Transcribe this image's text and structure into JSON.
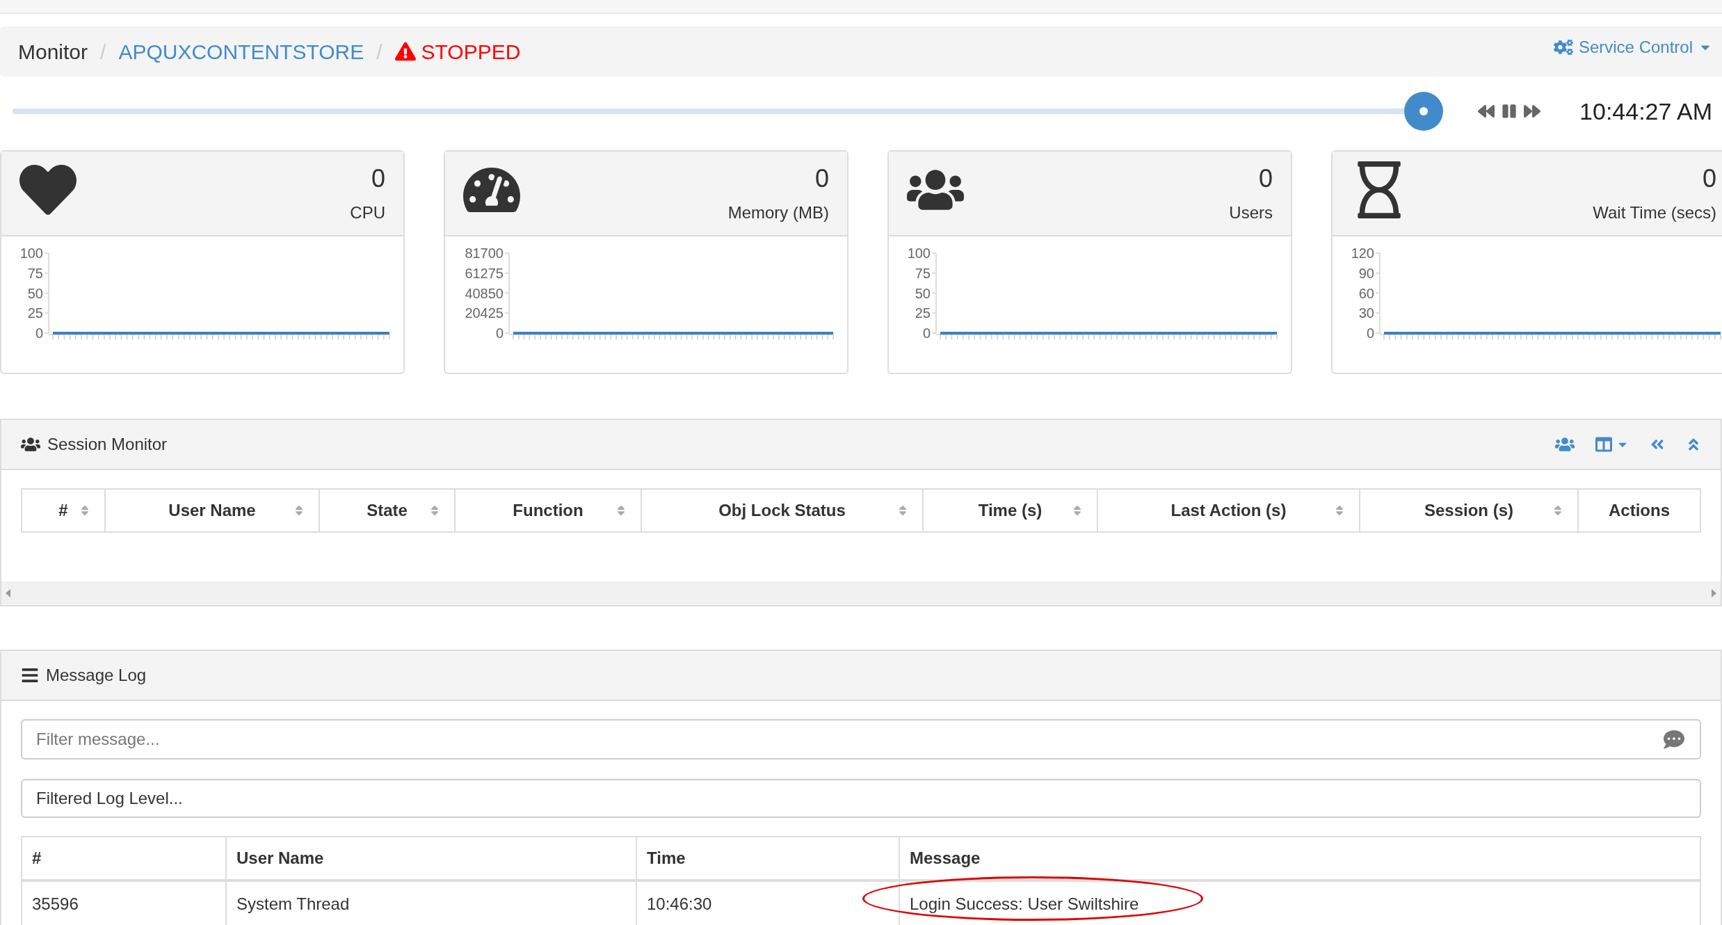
{
  "breadcrumb_separator": "/",
  "breadcrumb": [
    {
      "label": "Monitor",
      "kind": "plain"
    },
    {
      "label": "APQUXCONTENTSTORE",
      "kind": "link"
    },
    {
      "label": "STOPPED",
      "kind": "alert"
    }
  ],
  "service_control": {
    "label": "Service Control"
  },
  "timeline": {
    "level": 1,
    "time": "10:44:27 AM"
  },
  "cards": [
    {
      "kind": "heart",
      "value": "0",
      "label": "CPU",
      "chart_data": {
        "type": "line",
        "ylim": [
          0,
          100
        ],
        "yticks": [
          0,
          25,
          50,
          75,
          100
        ],
        "series": [
          {
            "color": "#3b82c4",
            "values": [
              0,
              0,
              0,
              0,
              0,
              0,
              0,
              0,
              0,
              0,
              0,
              0,
              0,
              0,
              0,
              0,
              0,
              0,
              0,
              0,
              0,
              0,
              0,
              0,
              0,
              0,
              0,
              0,
              0,
              0,
              0,
              0,
              0,
              0,
              0,
              0,
              0,
              0,
              0,
              0,
              0,
              0,
              0,
              0,
              0,
              0,
              0,
              0,
              0,
              0,
              0,
              0,
              0,
              0,
              0,
              0,
              0,
              0,
              0,
              0
            ]
          }
        ]
      }
    },
    {
      "kind": "gauge",
      "value": "0",
      "label": "Memory (MB)",
      "chart_data": {
        "type": "line",
        "ylim": [
          0,
          81700
        ],
        "yticks": [
          0,
          20425,
          40850,
          61275,
          81700
        ],
        "series": [
          {
            "color": "#3b82c4",
            "values": [
              0,
              0,
              0,
              0,
              0,
              0,
              0,
              0,
              0,
              0,
              0,
              0,
              0,
              0,
              0,
              0,
              0,
              0,
              0,
              0,
              0,
              0,
              0,
              0,
              0,
              0,
              0,
              0,
              0,
              0,
              0,
              0,
              0,
              0,
              0,
              0,
              0,
              0,
              0,
              0,
              0,
              0,
              0,
              0,
              0,
              0,
              0,
              0,
              0,
              0,
              0,
              0,
              0,
              0,
              0,
              0,
              0,
              0,
              0,
              0
            ]
          }
        ]
      }
    },
    {
      "kind": "users",
      "value": "0",
      "label": "Users",
      "chart_data": {
        "type": "line",
        "ylim": [
          0,
          100
        ],
        "yticks": [
          0,
          25,
          50,
          75,
          100
        ],
        "series": [
          {
            "color": "#3b82c4",
            "values": [
              0,
              0,
              0,
              0,
              0,
              0,
              0,
              0,
              0,
              0,
              0,
              0,
              0,
              0,
              0,
              0,
              0,
              0,
              0,
              0,
              0,
              0,
              0,
              0,
              0,
              0,
              0,
              0,
              0,
              0,
              0,
              0,
              0,
              0,
              0,
              0,
              0,
              0,
              0,
              0,
              0,
              0,
              0,
              0,
              0,
              0,
              0,
              0,
              0,
              0,
              0,
              0,
              0,
              0,
              0,
              0,
              0,
              0,
              0,
              0
            ]
          }
        ]
      }
    },
    {
      "kind": "hourglass",
      "value": "0",
      "label": "Wait Time (secs)",
      "chart_data": {
        "type": "line",
        "ylim": [
          0,
          120
        ],
        "yticks": [
          0,
          30,
          60,
          90,
          120
        ],
        "series": [
          {
            "color": "#3b82c4",
            "values": [
              0,
              0,
              0,
              0,
              0,
              0,
              0,
              0,
              0,
              0,
              0,
              0,
              0,
              0,
              0,
              0,
              0,
              0,
              0,
              0,
              0,
              0,
              0,
              0,
              0,
              0,
              0,
              0,
              0,
              0,
              0,
              0,
              0,
              0,
              0,
              0,
              0,
              0,
              0,
              0,
              0,
              0,
              0,
              0,
              0,
              0,
              0,
              0,
              0,
              0,
              0,
              0,
              0,
              0,
              0,
              0,
              0,
              0,
              0,
              0
            ]
          }
        ]
      }
    }
  ],
  "session_monitor": {
    "title": "Session Monitor",
    "columns": [
      {
        "label": "#",
        "sortable": true
      },
      {
        "label": "User Name",
        "sortable": true
      },
      {
        "label": "State",
        "sortable": true
      },
      {
        "label": "Function",
        "sortable": true
      },
      {
        "label": "Obj Lock Status",
        "sortable": true
      },
      {
        "label": "Time (s)",
        "sortable": true
      },
      {
        "label": "Last Action (s)",
        "sortable": true
      },
      {
        "label": "Session (s)",
        "sortable": true
      },
      {
        "label": "Actions",
        "sortable": false
      }
    ]
  },
  "message_log": {
    "title": "Message Log",
    "filter": {
      "placeholder": "Filter message..."
    },
    "level_filter": {
      "placeholder": "Filtered Log Level..."
    },
    "columns": [
      "#",
      "User Name",
      "Time",
      "Message"
    ],
    "rows": [
      {
        "cells": [
          "35596",
          "System Thread",
          "10:46:30",
          "Login Success: User Swiltshire"
        ],
        "circled": true
      }
    ]
  }
}
